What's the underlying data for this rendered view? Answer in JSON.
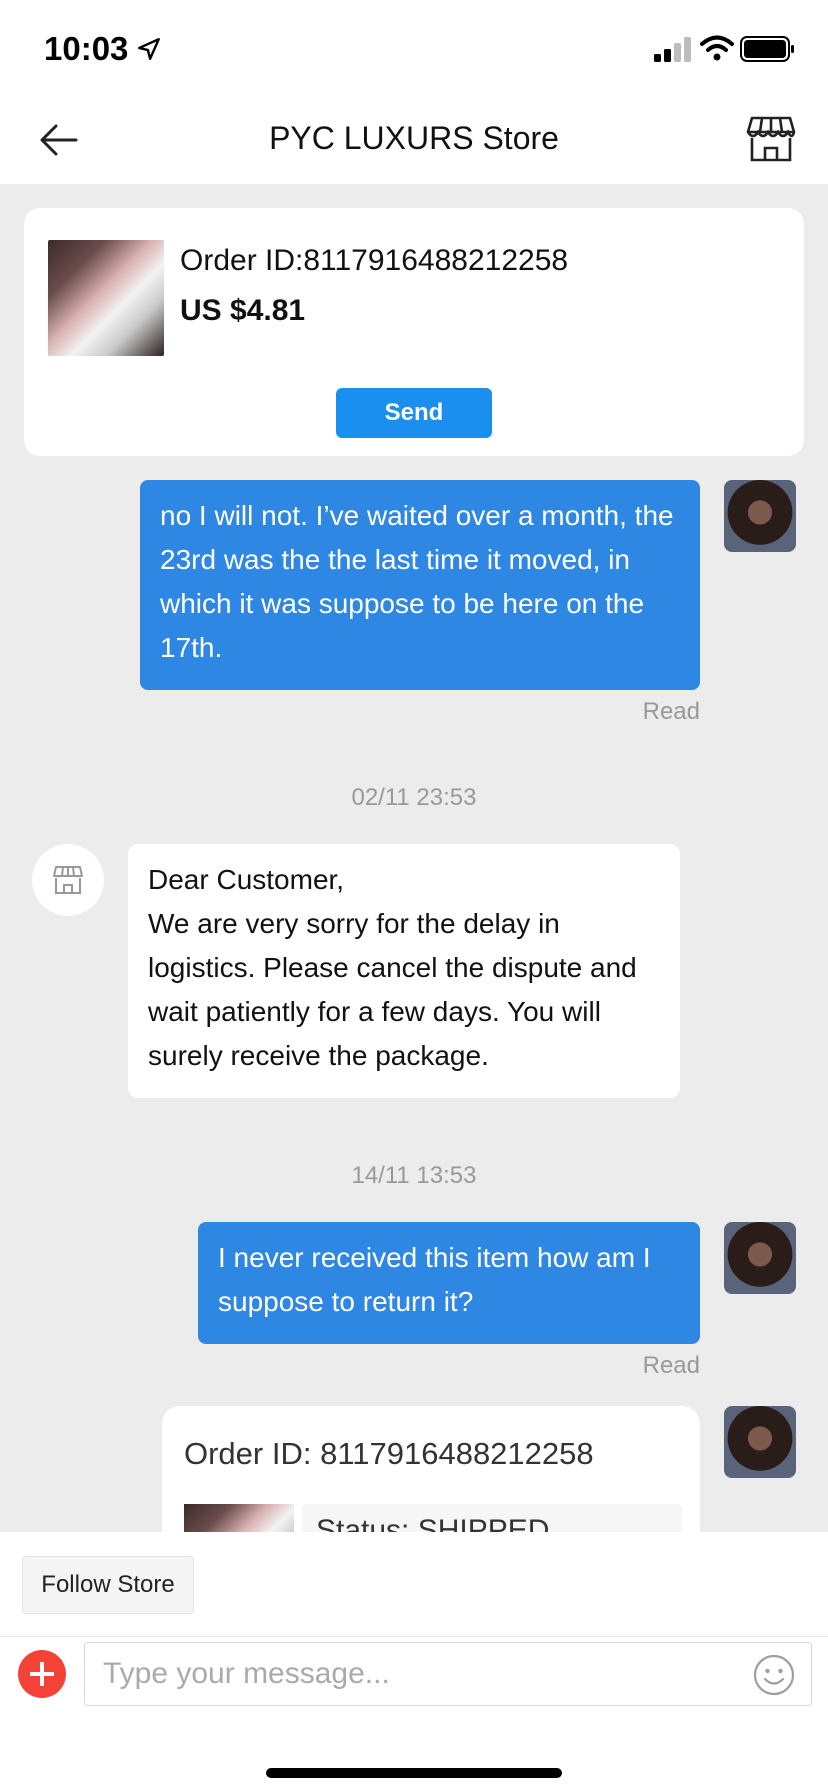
{
  "status_bar": {
    "time": "10:03"
  },
  "nav": {
    "title": "PYC LUXURS Store"
  },
  "order": {
    "id_label": "Order ID:8117916488212258",
    "price": "US $4.81",
    "send_label": "Send"
  },
  "messages": {
    "msg1": "no I will not. I’ve waited over a month, the 23rd was the the last time it moved, in which it was suppose to be here on the 17th.",
    "msg1_status": "Read",
    "ts1": "02/11 23:53",
    "msg2": "Dear Customer,\nWe are very sorry for the delay in logistics. Please cancel the dispute and wait patiently for a few days. You will surely receive the package.",
    "ts2": "14/11 13:53",
    "msg3": "I never received this item how am I suppose to return it?",
    "msg3_status": "Read",
    "order_card_id": "Order ID: 8117916488212258",
    "order_card_status": "Status:  SHIPPED"
  },
  "bottom": {
    "follow_label": "Follow Store",
    "input_placeholder": "Type your message..."
  },
  "colors": {
    "accent": "#1a8ff0",
    "bubble_out": "#2f87e4",
    "plus": "#f44336"
  },
  "icons": [
    "location-arrow-icon",
    "signal-icon",
    "wifi-icon",
    "battery-icon",
    "back-arrow-icon",
    "store-icon",
    "emoji-icon",
    "plus-icon"
  ]
}
